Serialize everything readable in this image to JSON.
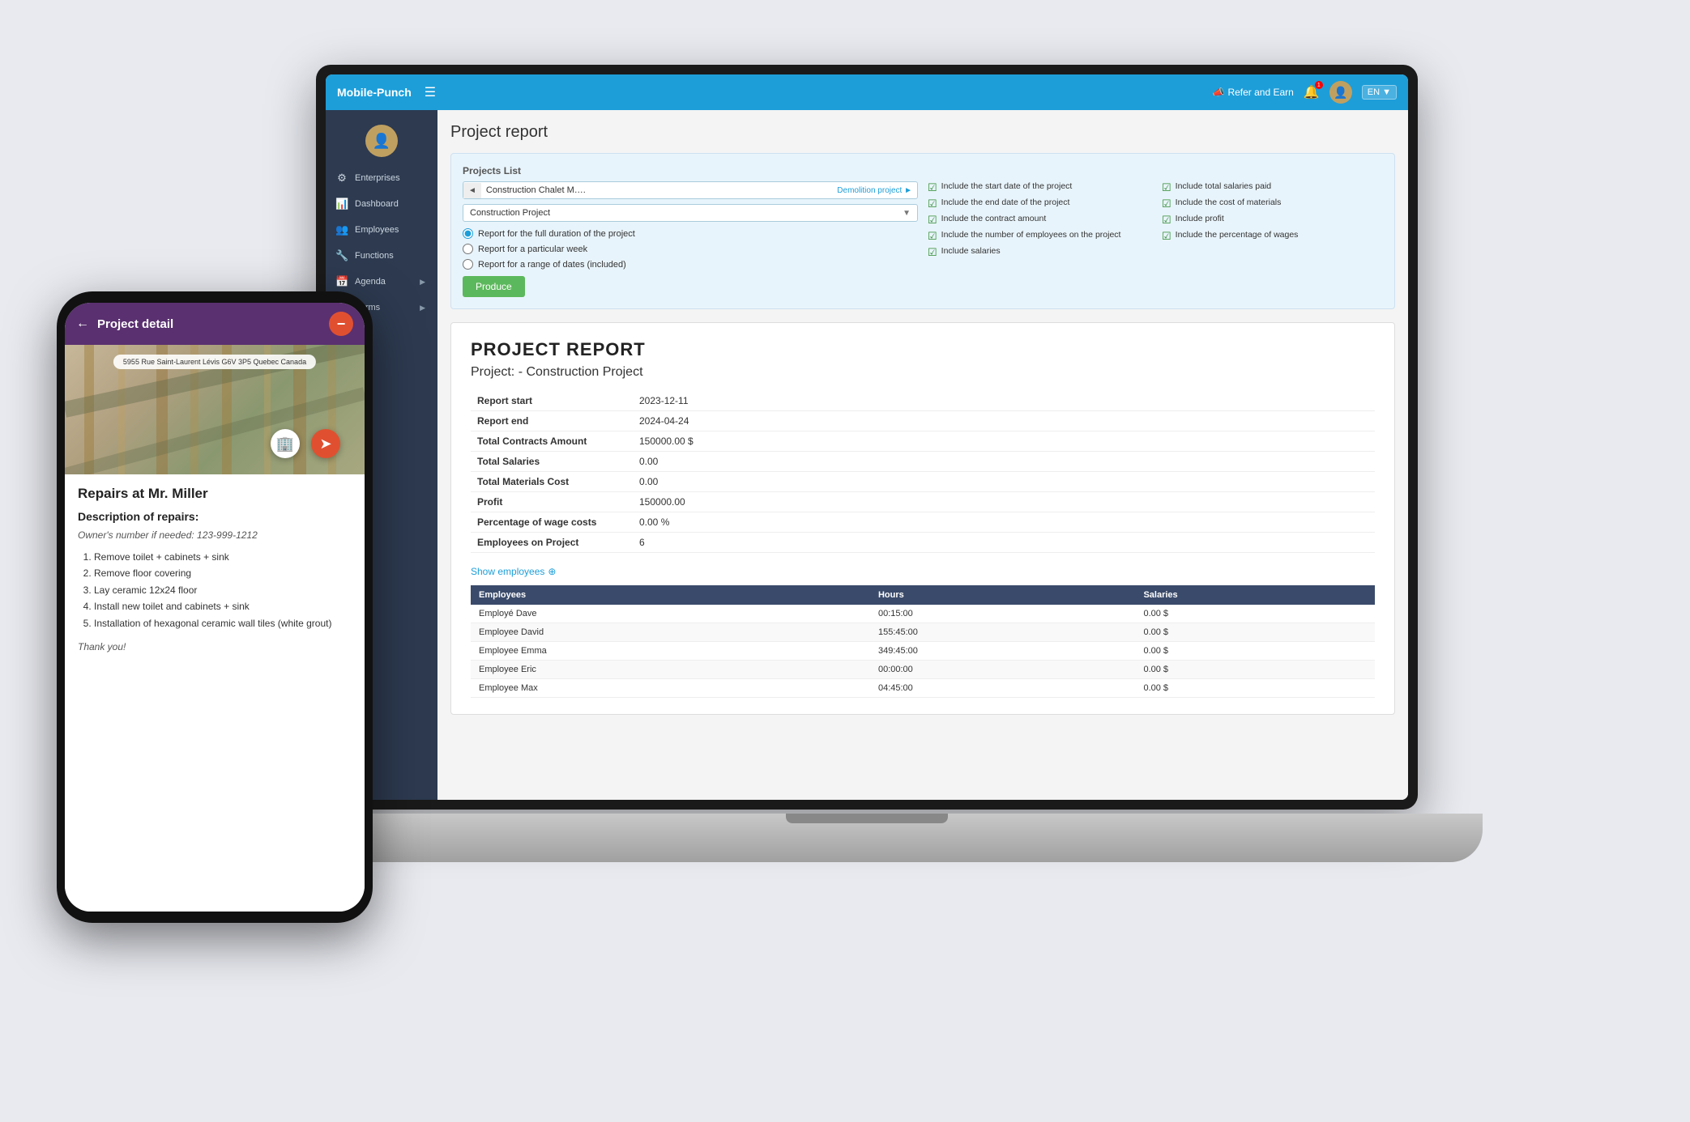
{
  "app": {
    "brand": "Mobile-Punch",
    "refer_earn": "Refer and Earn",
    "lang": "EN"
  },
  "sidebar": {
    "items": [
      {
        "label": "Enterprises",
        "icon": "⚙"
      },
      {
        "label": "Dashboard",
        "icon": "📊"
      },
      {
        "label": "Employees",
        "icon": "👥"
      },
      {
        "label": "Functions",
        "icon": "🔧"
      },
      {
        "label": "Agenda",
        "icon": "📅"
      },
      {
        "label": "Forms",
        "icon": "📋"
      }
    ]
  },
  "report_page": {
    "title": "Project report",
    "projects_list_label": "Projects List",
    "project_nav_left": "◄",
    "project_nav_name": "Construction Chalet M….",
    "project_nav_tag": "Demolition project ►",
    "project_dropdown": "Construction Project",
    "radio_options": [
      {
        "label": "Report for the full duration of the project",
        "checked": true
      },
      {
        "label": "Report for a particular week",
        "checked": false
      },
      {
        "label": "Report for a range of dates (included)",
        "checked": false
      }
    ],
    "checkboxes": [
      {
        "label": "Include the start date of the project",
        "checked": true
      },
      {
        "label": "Include the end date of the project",
        "checked": true
      },
      {
        "label": "Include the contract amount",
        "checked": true
      },
      {
        "label": "Include the number of employees on the project",
        "checked": true
      },
      {
        "label": "Include salaries",
        "checked": true
      },
      {
        "label": "Include total salaries paid",
        "checked": true
      },
      {
        "label": "Include the cost of materials",
        "checked": true
      },
      {
        "label": "Include profit",
        "checked": true
      },
      {
        "label": "Include the percentage of wages",
        "checked": true
      }
    ],
    "produce_btn": "Produce"
  },
  "report_output": {
    "main_title": "PROJECT REPORT",
    "project_label": "Project: - Construction Project",
    "summary_rows": [
      {
        "label": "Report start",
        "value": "2023-12-11"
      },
      {
        "label": "Report end",
        "value": "2024-04-24"
      },
      {
        "label": "Total Contracts Amount",
        "value": "150000.00 $"
      },
      {
        "label": "Total Salaries",
        "value": "0.00"
      },
      {
        "label": "Total Materials Cost",
        "value": "0.00"
      },
      {
        "label": "Profit",
        "value": "150000.00"
      },
      {
        "label": "Percentage of wage costs",
        "value": "0.00 %"
      },
      {
        "label": "Employees on Project",
        "value": "6"
      }
    ],
    "show_employees": "Show employees",
    "employees_table": {
      "headers": [
        "Employees",
        "Hours",
        "Salaries"
      ],
      "rows": [
        {
          "name": "Employé Dave",
          "hours": "00:15:00",
          "salaries": "0.00 $"
        },
        {
          "name": "Employee David",
          "hours": "155:45:00",
          "salaries": "0.00 $"
        },
        {
          "name": "Employee Emma",
          "hours": "349:45:00",
          "salaries": "0.00 $"
        },
        {
          "name": "Employee Eric",
          "hours": "00:00:00",
          "salaries": "0.00 $"
        },
        {
          "name": "Employee Max",
          "hours": "04:45:00",
          "salaries": "0.00 $"
        }
      ]
    }
  },
  "phone": {
    "title": "Project detail",
    "back_icon": "←",
    "minus_icon": "−",
    "address": "5955 Rue Saint-Laurent Lévis G6V 3P5 Quebec Canada",
    "repair_title": "Repairs at Mr. Miller",
    "description_title": "Description of repairs:",
    "owner_note": "Owner's number if needed: 123-999-1212",
    "repair_items": [
      "Remove toilet + cabinets + sink",
      "Remove floor covering",
      "Lay ceramic 12x24 floor",
      "Install new toilet and cabinets + sink",
      "Installation of hexagonal ceramic wall tiles (white grout)"
    ],
    "thanks": "Thank you!"
  }
}
